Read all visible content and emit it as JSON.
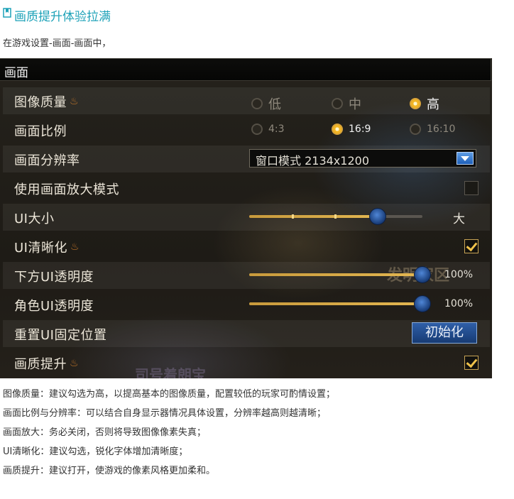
{
  "heading": {
    "text": "画质提升体验拉满",
    "icon": "bookmark-icon"
  },
  "intro": "在游戏设置-画面-画面中，",
  "panel": {
    "title": "画面",
    "deco_text_a": "发明家区",
    "deco_text_b": "司号着朗宝",
    "rows": [
      {
        "label": "图像质量",
        "options": [
          "低",
          "中",
          "高"
        ],
        "selected": "高"
      },
      {
        "label": "画面比例",
        "options": [
          "4:3",
          "16:9",
          "16:10"
        ],
        "selected": "16:9"
      },
      {
        "label": "画面分辨率",
        "value": "窗口模式  2134x1200"
      },
      {
        "label": "使用画面放大模式",
        "checked": false
      },
      {
        "label": "UI大小",
        "value_label": "大",
        "level": 0.74
      },
      {
        "label": "UI清晰化",
        "checked": true
      },
      {
        "label": "下方UI透明度",
        "value_label": "100%",
        "level": 1.0
      },
      {
        "label": "角色UI透明度",
        "value_label": "100%",
        "level": 1.0
      },
      {
        "label": "重置UI固定位置",
        "button": "初始化"
      },
      {
        "label": "画质提升",
        "checked": true
      }
    ]
  },
  "notes": [
    "图像质量：建议勾选为高，以提高基本的图像质量，配置较低的玩家可酌情设置；",
    "画面比例与分辨率：可以结合自身显示器情况具体设置，分辨率越高则越清晰；",
    "画面放大：务必关闭，否则将导致图像像素失真；",
    "UI清晰化：建议勾选，锐化字体增加清晰度；",
    "画质提升：建议打开，使游戏的像素风格更加柔和。"
  ],
  "colors": {
    "accent": "#1ea2b8",
    "gold": "#f2b524",
    "blue": "#1e5fb8"
  }
}
